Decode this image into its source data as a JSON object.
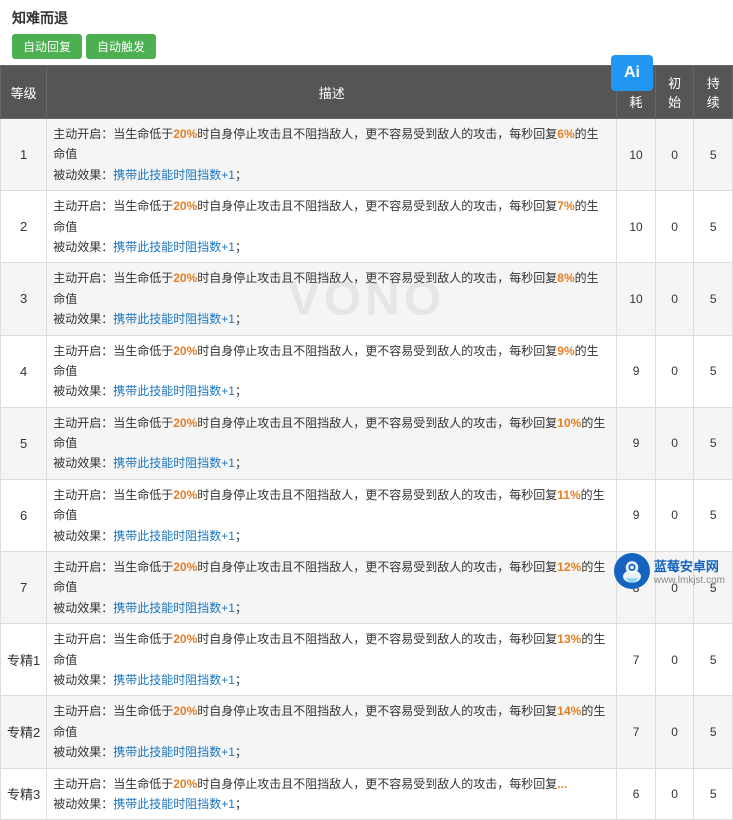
{
  "skill": {
    "name": "知难而退",
    "btn_auto_recover": "自动回复",
    "btn_auto_trigger": "自动触发"
  },
  "table": {
    "headers": [
      "等级",
      "描述",
      "消耗",
      "初始",
      "持续"
    ],
    "rows": [
      {
        "level": "1",
        "desc_main": "主动开启：当生命低于20%时自身停止攻击且不阻挡敌人，更不容易受到敌人的攻击，每秒回复6%的生命值",
        "desc_sub": "被动效果：携带此技能时阻挡数+1；",
        "highlight": "6%",
        "cost": "10",
        "initial": "0",
        "duration": "5"
      },
      {
        "level": "2",
        "desc_main": "主动开启：当生命低于20%时自身停止攻击且不阻挡敌人，更不容易受到敌人的攻击，每秒回复7%的生命值",
        "desc_sub": "被动效果：携带此技能时阻挡数+1；",
        "highlight": "7%",
        "cost": "10",
        "initial": "0",
        "duration": "5"
      },
      {
        "level": "3",
        "desc_main": "主动开启：当生命低于20%时自身停止攻击且不阻挡敌人，更不容易受到敌人的攻击，每秒回复8%的生命值",
        "desc_sub": "被动效果：携带此技能时阻挡数+1；",
        "highlight": "8%",
        "cost": "10",
        "initial": "0",
        "duration": "5"
      },
      {
        "level": "4",
        "desc_main": "主动开启：当生命低于20%时自身停止攻击且不阻挡敌人，更不容易受到敌人的攻击，每秒回复9%的生命值",
        "desc_sub": "被动效果：携带此技能时阻挡数+1；",
        "highlight": "9%",
        "cost": "9",
        "initial": "0",
        "duration": "5"
      },
      {
        "level": "5",
        "desc_main": "主动开启：当生命低于20%时自身停止攻击且不阻挡敌人，更不容易受到敌人的攻击，每秒回复10%的生命值",
        "desc_sub": "被动效果：携带此技能时阻挡数+1；",
        "highlight": "10%",
        "cost": "9",
        "initial": "0",
        "duration": "5"
      },
      {
        "level": "6",
        "desc_main": "主动开启：当生命低于20%时自身停止攻击且不阻挡敌人，更不容易受到敌人的攻击，每秒回复11%的生命值",
        "desc_sub": "被动效果：携带此技能时阻挡数+1；",
        "highlight": "11%",
        "cost": "9",
        "initial": "0",
        "duration": "5"
      },
      {
        "level": "7",
        "desc_main": "主动开启：当生命低于20%时自身停止攻击且不阻挡敌人，更不容易受到敌人的攻击，每秒回复12%的生命值",
        "desc_sub": "被动效果：携带此技能时阻挡数+1；",
        "highlight": "12%",
        "cost": "8",
        "initial": "0",
        "duration": "5"
      },
      {
        "level": "专精1",
        "desc_main": "主动开启：当生命低于20%时自身停止攻击且不阻挡敌人，更不容易受到敌人的攻击，每秒回复13%的生命值",
        "desc_sub": "被动效果：携带此技能时阻挡数+1；",
        "highlight": "13%",
        "cost": "7",
        "initial": "0",
        "duration": "5"
      },
      {
        "level": "专精2",
        "desc_main": "主动开启：当生命低于20%时自身停止攻击且不阻挡敌人，更不容易受到敌人的攻击，每秒回复14%的生命值",
        "desc_sub": "被动效果：携带此技能时阻挡数+1；",
        "highlight": "14%",
        "cost": "7",
        "initial": "0",
        "duration": "5"
      },
      {
        "level": "专精3",
        "desc_main": "主动开启：当生命低于20%时自身停止攻击且不阻挡敌人，更不容易受到敌人的攻击，每秒回复",
        "desc_sub": "被动效果：携带此技能时阻挡数+1；",
        "highlight": "",
        "cost": "6",
        "initial": "0",
        "duration": "5"
      }
    ]
  },
  "watermark": "VONO",
  "logo": {
    "text": "蓝莓安卓网",
    "url_text": "www.lmkjst.com"
  },
  "ai_label": "Ai"
}
